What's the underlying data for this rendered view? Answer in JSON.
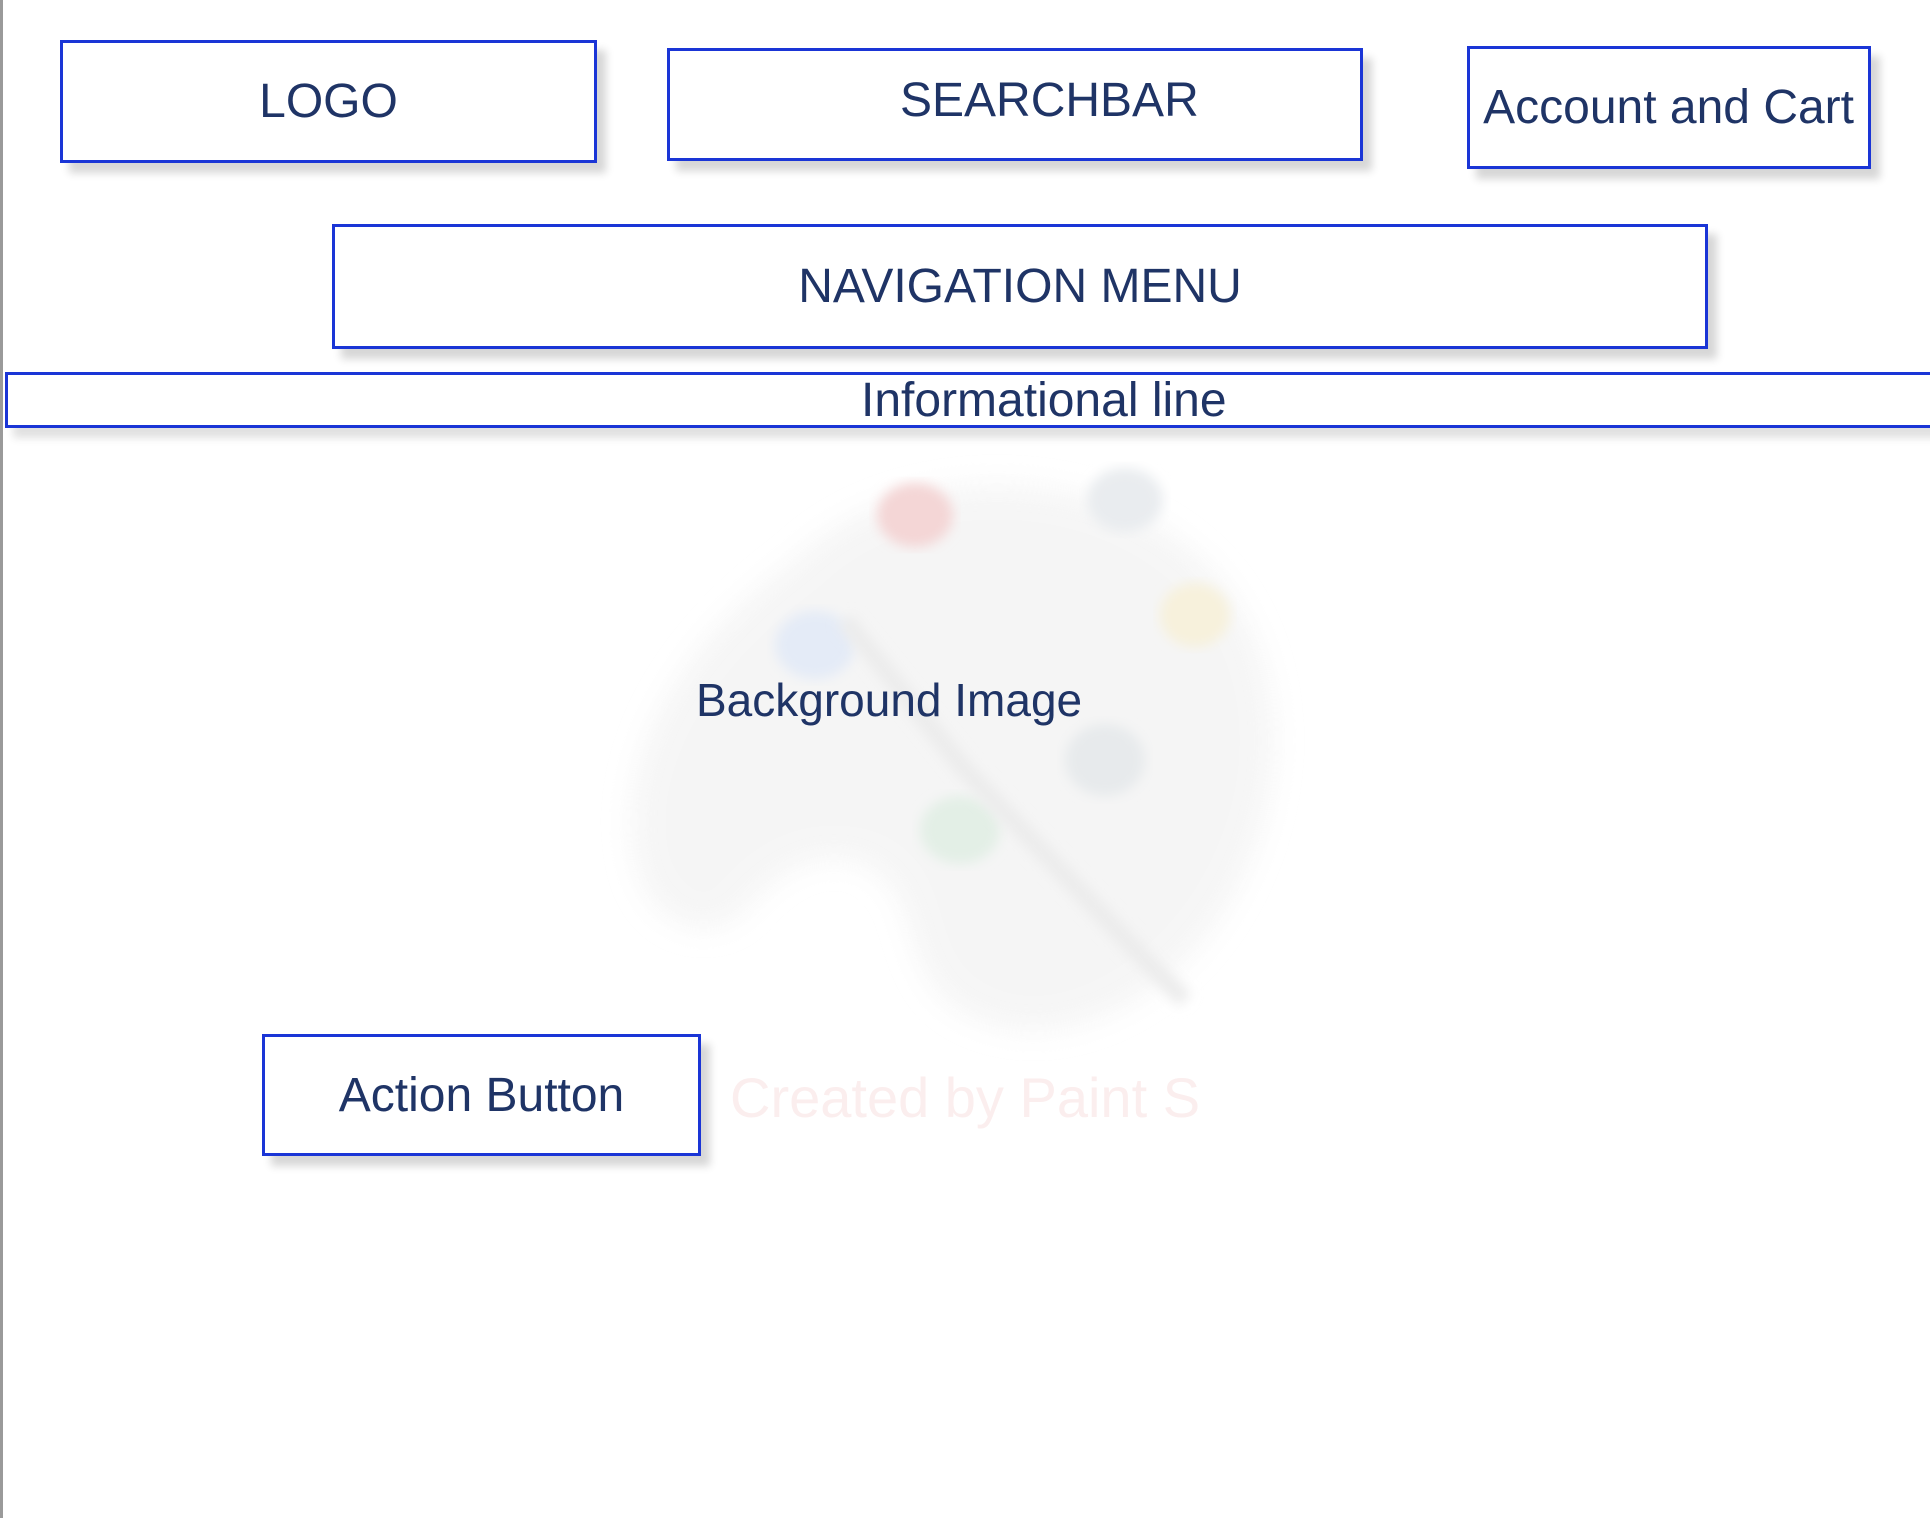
{
  "wireframe": {
    "logo_label": "LOGO",
    "searchbar_label": "SEARCHBAR",
    "account_cart_label": "Account and Cart",
    "navigation_label": "NAVIGATION MENU",
    "info_line_label": "Informational line",
    "background_image_label": "Background Image",
    "action_button_label": "Action Button"
  },
  "watermark": {
    "text": "Created by Paint S",
    "icon": "paint-palette-icon"
  },
  "colors": {
    "box_border": "#1a35d6",
    "label_text": "#1f3466",
    "watermark_text": "#fbeeee"
  }
}
